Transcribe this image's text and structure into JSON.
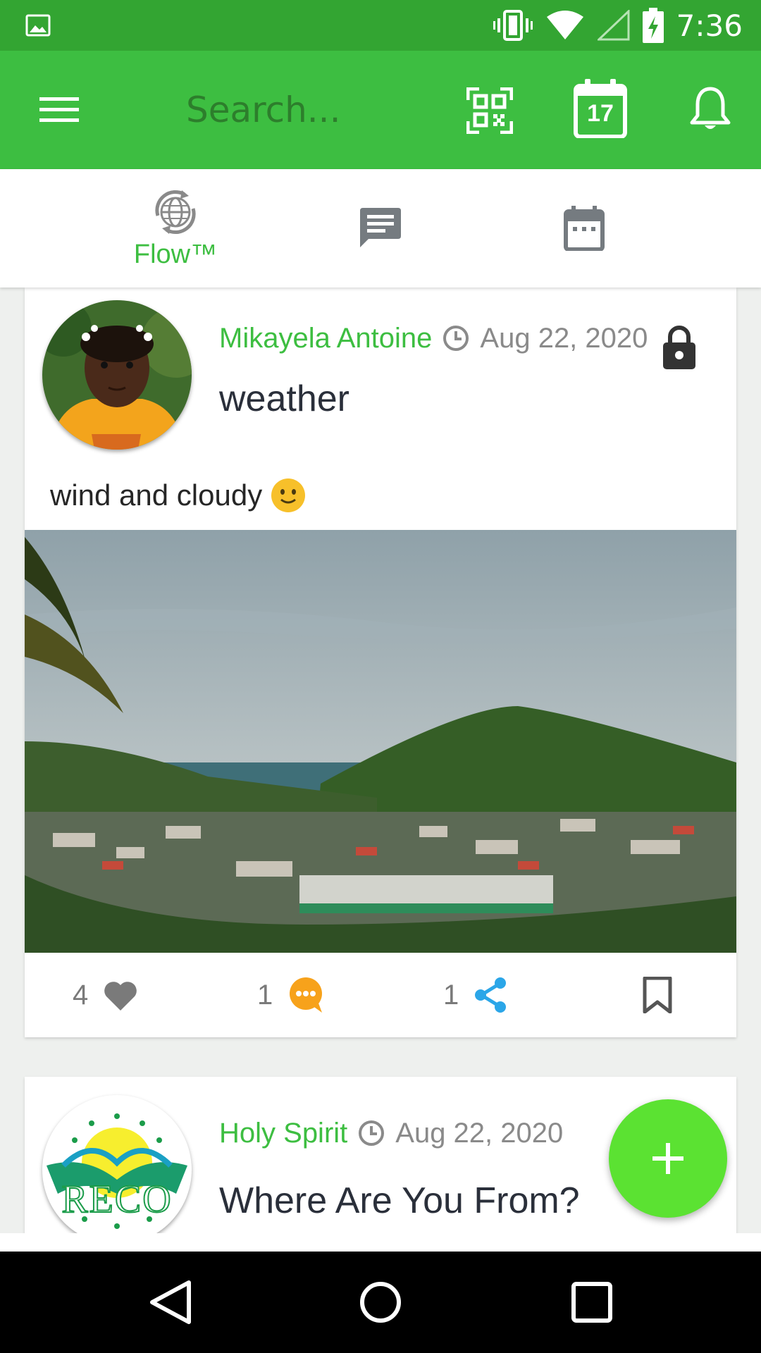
{
  "status_bar": {
    "time": "7:36",
    "icons": [
      "gallery-icon",
      "vibrate-icon",
      "wifi-icon",
      "signal-icon",
      "battery-charging-icon"
    ]
  },
  "toolbar": {
    "menu_icon": "menu-icon",
    "search_placeholder": "Search...",
    "qr_icon": "qr-scan-icon",
    "calendar_day": "17",
    "bell_icon": "bell-icon"
  },
  "tabs": [
    {
      "label": "Flow™",
      "icon": "globe-sync-icon",
      "active": true
    },
    {
      "label": "",
      "icon": "chat-icon",
      "active": false
    },
    {
      "label": "",
      "icon": "calendar-icon",
      "active": false
    }
  ],
  "posts": [
    {
      "author": "Mikayela Antoine",
      "date": "Aug 22, 2020",
      "title": "weather",
      "text": "wind and cloudy",
      "emoji": "slightly-smiling-face",
      "locked": true,
      "likes": "4",
      "comments": "1",
      "shares": "1"
    },
    {
      "author": "Holy Spirit",
      "date": "Aug 22, 2020",
      "title": "Where Are You From?",
      "avatar_text": "RECO"
    }
  ],
  "colors": {
    "status_bar": "#33a532",
    "toolbar": "#3dbe41",
    "accent": "#3dbe41",
    "fab": "#5be232",
    "comment": "#f7a21b",
    "share": "#2ba6e8"
  }
}
